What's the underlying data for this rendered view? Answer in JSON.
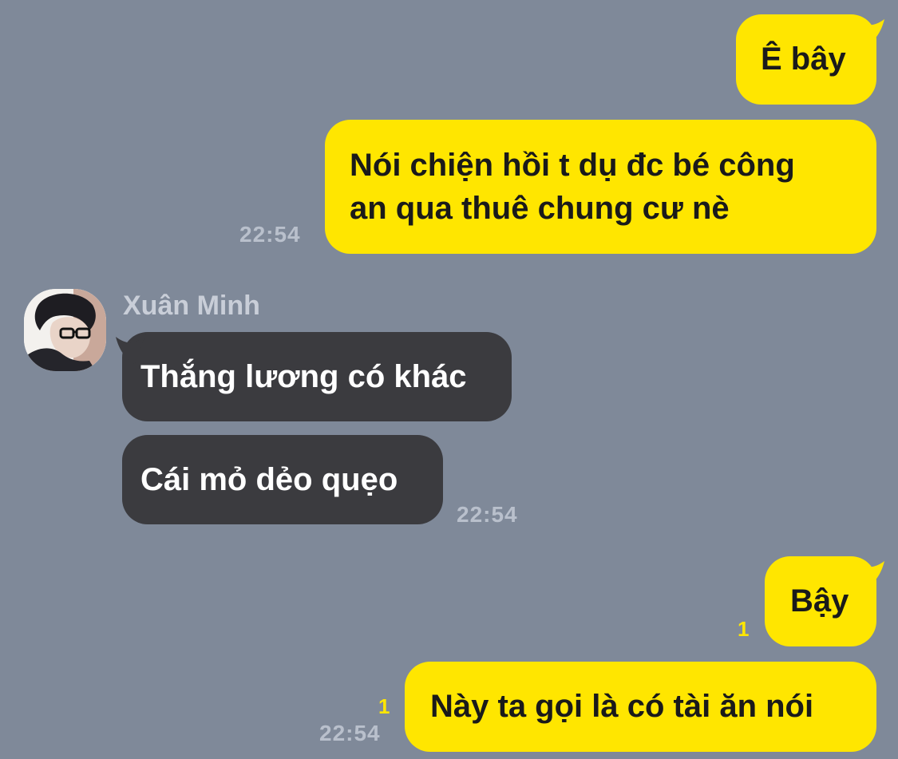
{
  "chat": {
    "messages": [
      {
        "sender": "me",
        "text": "Ê bây"
      },
      {
        "sender": "me",
        "lines": [
          "Nói chiện hồi t dụ đc bé công",
          "an qua thuê chung cư nè"
        ],
        "time": "22:54"
      },
      {
        "sender": "other",
        "name": "Xuân Minh",
        "text": "Thắng lương có khác"
      },
      {
        "sender": "other",
        "text": "Cái mỏ dẻo quẹo",
        "time": "22:54"
      },
      {
        "sender": "me",
        "text": "Bậy",
        "unread": "1"
      },
      {
        "sender": "me",
        "text": "Này ta gọi là có tài ăn nói",
        "unread": "1",
        "time": "22:54"
      }
    ]
  },
  "colors": {
    "background": "#7f8999",
    "my_bubble": "#ffe600",
    "their_bubble": "#3b3b3f",
    "unread_count": "#ffe600"
  }
}
